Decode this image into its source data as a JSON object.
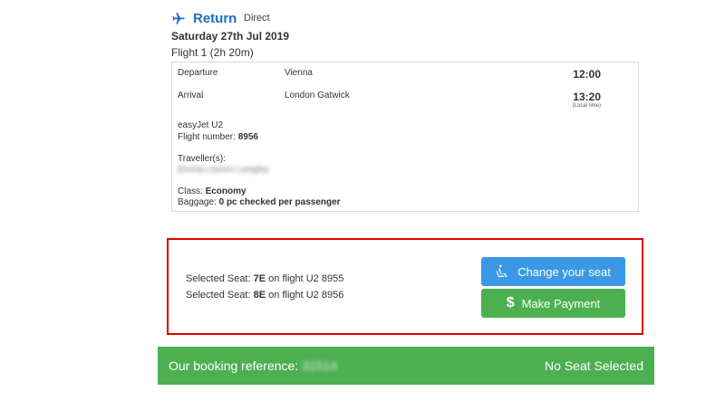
{
  "header": {
    "title": "Return",
    "direct_label": "Direct",
    "date": "Saturday 27th Jul 2019",
    "flight_title": "Flight 1 (2h 20m)"
  },
  "details": {
    "departure_label": "Departure",
    "departure_city": "Vienna",
    "departure_time": "12:00",
    "arrival_label": "Arrival",
    "arrival_city": "London Gatwick",
    "arrival_time": "13:20",
    "local_time_note": "(Local time)",
    "airline": "easyJet U2",
    "flight_number_label": "Flight number:",
    "flight_number": "8956",
    "travellers_label": "Traveller(s):",
    "traveller_name": "Emma Lauren Langley",
    "class_label": "Class:",
    "class_value": "Economy",
    "baggage_label": "Baggage:",
    "baggage_value": "0 pc checked per passenger"
  },
  "seats": {
    "line1_prefix": "Selected Seat:",
    "line1_seat": "7E",
    "line1_suffix": "on flight U2 8955",
    "line2_prefix": "Selected Seat:",
    "line2_seat": "8E",
    "line2_suffix": "on flight U2 8956",
    "change_button": "Change your seat",
    "payment_button": "Make Payment"
  },
  "footer": {
    "booking_label": "Our booking reference:",
    "booking_value": "31514",
    "no_seat": "No Seat Selected"
  },
  "colors": {
    "accent_blue": "#1d6fbf",
    "button_blue": "#3a98e6",
    "green": "#4caf50",
    "highlight_red": "#e00000"
  },
  "icons": [
    "airplane-icon",
    "seat-icon",
    "dollar-icon"
  ]
}
